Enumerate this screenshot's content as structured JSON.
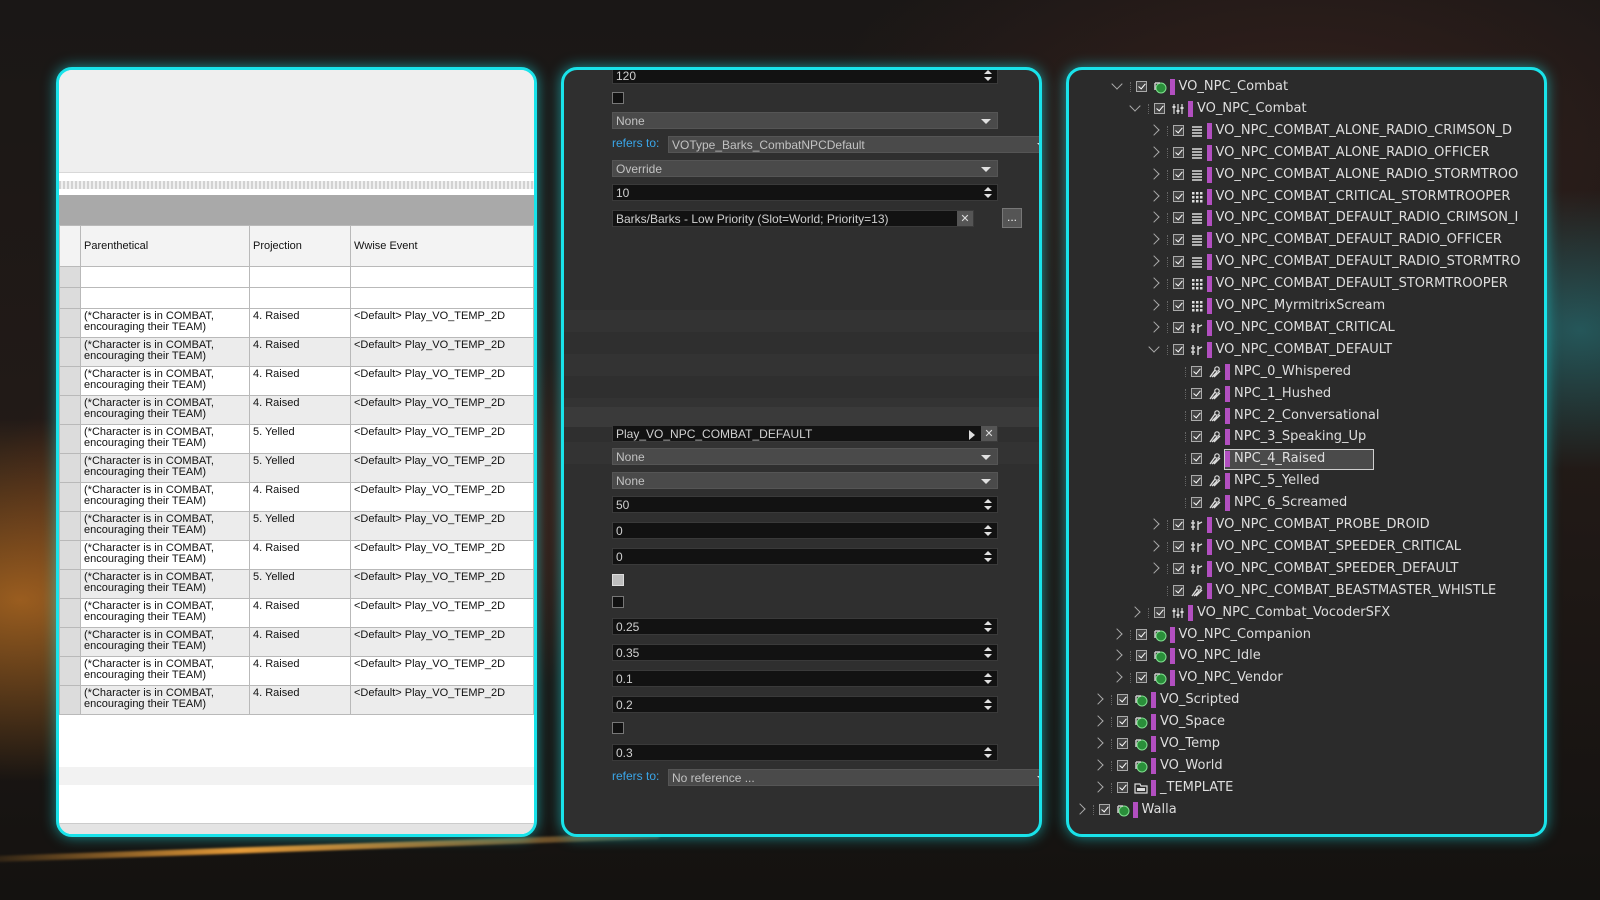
{
  "spreadsheet": {
    "columns": [
      "Parenthetical",
      "Projection",
      "Wwise Event"
    ],
    "rows": [
      {
        "parenthetical": "(*Character is in COMBAT, encouraging their TEAM)",
        "projection": "4. Raised",
        "event": "<Default> Play_VO_TEMP_2D"
      },
      {
        "parenthetical": "(*Character is in COMBAT, encouraging their TEAM)",
        "projection": "4. Raised",
        "event": "<Default> Play_VO_TEMP_2D"
      },
      {
        "parenthetical": "(*Character is in COMBAT, encouraging their TEAM)",
        "projection": "4. Raised",
        "event": "<Default> Play_VO_TEMP_2D"
      },
      {
        "parenthetical": "(*Character is in COMBAT, encouraging their TEAM)",
        "projection": "4. Raised",
        "event": "<Default> Play_VO_TEMP_2D"
      },
      {
        "parenthetical": "(*Character is in COMBAT, encouraging their TEAM)",
        "projection": "5. Yelled",
        "event": "<Default> Play_VO_TEMP_2D"
      },
      {
        "parenthetical": "(*Character is in COMBAT, encouraging their TEAM)",
        "projection": "5. Yelled",
        "event": "<Default> Play_VO_TEMP_2D"
      },
      {
        "parenthetical": "(*Character is in COMBAT, encouraging their TEAM)",
        "projection": "4. Raised",
        "event": "<Default> Play_VO_TEMP_2D"
      },
      {
        "parenthetical": "(*Character is in COMBAT, encouraging their TEAM)",
        "projection": "5. Yelled",
        "event": "<Default> Play_VO_TEMP_2D"
      },
      {
        "parenthetical": "(*Character is in COMBAT, encouraging their TEAM)",
        "projection": "4. Raised",
        "event": "<Default> Play_VO_TEMP_2D"
      },
      {
        "parenthetical": "(*Character is in COMBAT, encouraging their TEAM)",
        "projection": "5. Yelled",
        "event": "<Default> Play_VO_TEMP_2D"
      },
      {
        "parenthetical": "(*Character is in COMBAT, encouraging their TEAM)",
        "projection": "4. Raised",
        "event": "<Default> Play_VO_TEMP_2D"
      },
      {
        "parenthetical": "(*Character is in COMBAT, encouraging their TEAM)",
        "projection": "4. Raised",
        "event": "<Default> Play_VO_TEMP_2D"
      },
      {
        "parenthetical": "(*Character is in COMBAT, encouraging their TEAM)",
        "projection": "4. Raised",
        "event": "<Default> Play_VO_TEMP_2D"
      },
      {
        "parenthetical": "(*Character is in COMBAT, encouraging their TEAM)",
        "projection": "4. Raised",
        "event": "<Default> Play_VO_TEMP_2D"
      }
    ]
  },
  "properties": {
    "top_value": "120",
    "combo_none_1": "None",
    "refers_label": "refers to:",
    "refers_value_1": "VOType_Barks_CombatNPCDefault",
    "override": "Override",
    "value_10": "10",
    "slot_path": "Barks/Barks - Low Priority (Slot=World; Priority=13)",
    "clear_glyph": "✕",
    "browse_glyph": "...",
    "event_name": "Play_VO_NPC_COMBAT_DEFAULT",
    "combo_none_2": "None",
    "combo_none_3": "None",
    "value_50": "50",
    "value_0a": "0",
    "value_0b": "0",
    "value_025": "0.25",
    "value_035": "0.35",
    "value_01": "0.1",
    "value_02": "0.2",
    "value_03": "0.3",
    "refers_value_2": "No reference ..."
  },
  "tree": {
    "accent": "#b24fc0",
    "nodes": [
      {
        "label": "VO_NPC_Combat",
        "icon": "work-unit-icon"
      },
      {
        "label": "VO_NPC_Combat",
        "icon": "actor-mixer-icon"
      },
      {
        "label": "VO_NPC_COMBAT_ALONE_RADIO_CRIMSON_D",
        "icon": "sequence-container-icon"
      },
      {
        "label": "VO_NPC_COMBAT_ALONE_RADIO_OFFICER",
        "icon": "sequence-container-icon"
      },
      {
        "label": "VO_NPC_COMBAT_ALONE_RADIO_STORMTROO",
        "icon": "sequence-container-icon"
      },
      {
        "label": "VO_NPC_COMBAT_CRITICAL_STORMTROOPER",
        "icon": "random-container-icon"
      },
      {
        "label": "VO_NPC_COMBAT_DEFAULT_RADIO_CRIMSON_I",
        "icon": "sequence-container-icon"
      },
      {
        "label": "VO_NPC_COMBAT_DEFAULT_RADIO_OFFICER",
        "icon": "sequence-container-icon"
      },
      {
        "label": "VO_NPC_COMBAT_DEFAULT_RADIO_STORMTRO",
        "icon": "sequence-container-icon"
      },
      {
        "label": "VO_NPC_COMBAT_DEFAULT_STORMTROOPER",
        "icon": "random-container-icon"
      },
      {
        "label": "VO_NPC_MyrmitrixScream",
        "icon": "random-container-icon"
      },
      {
        "label": "VO_NPC_COMBAT_CRITICAL",
        "icon": "switch-container-icon"
      },
      {
        "label": "VO_NPC_COMBAT_DEFAULT",
        "icon": "switch-container-icon"
      },
      {
        "label": "NPC_0_Whispered",
        "icon": "voice-icon"
      },
      {
        "label": "NPC_1_Hushed",
        "icon": "voice-icon"
      },
      {
        "label": "NPC_2_Conversational",
        "icon": "voice-icon"
      },
      {
        "label": "NPC_3_Speaking_Up",
        "icon": "voice-icon"
      },
      {
        "label": "NPC_4_Raised",
        "icon": "voice-icon"
      },
      {
        "label": "NPC_5_Yelled",
        "icon": "voice-icon"
      },
      {
        "label": "NPC_6_Screamed",
        "icon": "voice-icon"
      },
      {
        "label": "VO_NPC_COMBAT_PROBE_DROID",
        "icon": "switch-container-icon"
      },
      {
        "label": "VO_NPC_COMBAT_SPEEDER_CRITICAL",
        "icon": "switch-container-icon"
      },
      {
        "label": "VO_NPC_COMBAT_SPEEDER_DEFAULT",
        "icon": "switch-container-icon"
      },
      {
        "label": "VO_NPC_COMBAT_BEASTMASTER_WHISTLE",
        "icon": "voice-icon"
      },
      {
        "label": "VO_NPC_Combat_VocoderSFX",
        "icon": "actor-mixer-icon"
      },
      {
        "label": "VO_NPC_Companion",
        "icon": "work-unit-icon"
      },
      {
        "label": "VO_NPC_Idle",
        "icon": "work-unit-icon"
      },
      {
        "label": "VO_NPC_Vendor",
        "icon": "work-unit-icon"
      },
      {
        "label": "VO_Scripted",
        "icon": "work-unit-icon"
      },
      {
        "label": "VO_Space",
        "icon": "work-unit-icon"
      },
      {
        "label": "VO_Temp",
        "icon": "work-unit-icon"
      },
      {
        "label": "VO_World",
        "icon": "work-unit-icon"
      },
      {
        "label": "_TEMPLATE",
        "icon": "folder-icon"
      },
      {
        "label": "Walla",
        "icon": "work-unit-icon"
      }
    ]
  }
}
